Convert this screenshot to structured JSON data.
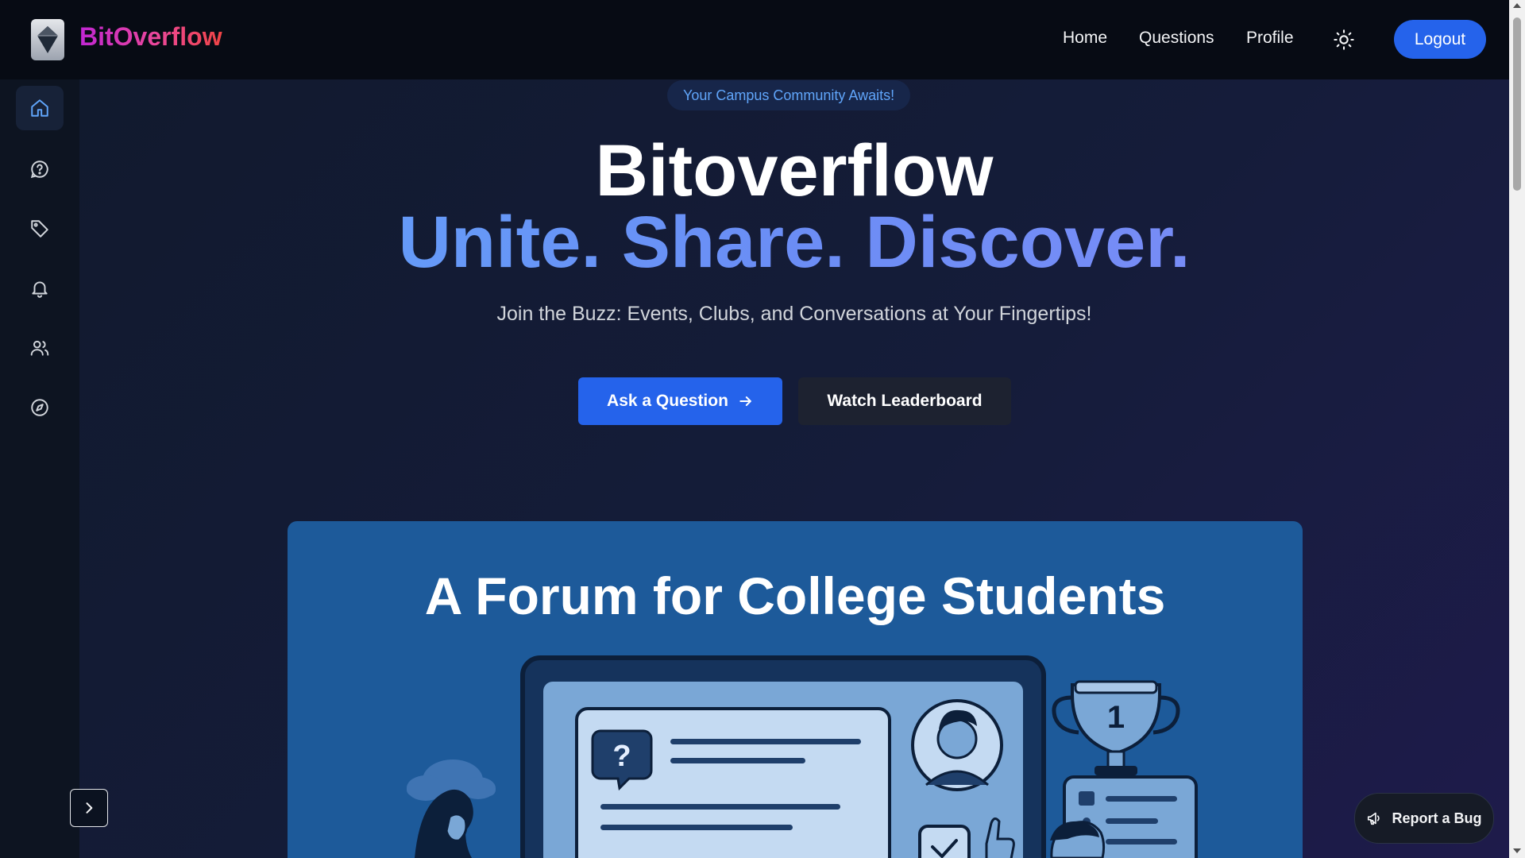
{
  "app": {
    "brand": "BitOverflow"
  },
  "nav": {
    "links": [
      "Home",
      "Questions",
      "Profile"
    ],
    "theme_icon": "sun-icon",
    "logout_label": "Logout"
  },
  "sidebar": {
    "items": [
      {
        "icon": "home-icon",
        "active": true
      },
      {
        "icon": "question-chat-icon",
        "active": false
      },
      {
        "icon": "tag-icon",
        "active": false
      },
      {
        "icon": "bell-icon",
        "active": false
      },
      {
        "icon": "users-icon",
        "active": false
      },
      {
        "icon": "compass-icon",
        "active": false
      }
    ],
    "expand_icon": "chevron-right-icon"
  },
  "hero": {
    "badge": "Your Campus Community Awaits!",
    "title": "Bitoverflow",
    "tagline": "Unite. Share. Discover.",
    "subtitle": "Join the Buzz: Events, Clubs, and Conversations at Your Fingertips!",
    "primary_cta": "Ask a Question",
    "secondary_cta": "Watch Leaderboard"
  },
  "feature_card": {
    "title": "A Forum for College Students",
    "trophy_rank": "1"
  },
  "report": {
    "label": "Report a Bug",
    "icon": "megaphone-icon"
  },
  "colors": {
    "accent": "#2563eb",
    "brand_gradient_start": "#c026d3",
    "brand_gradient_end": "#ef4444",
    "tagline_gradient_start": "#60a5fa",
    "tagline_gradient_end": "#818cf8",
    "card_bg": "#1d5a9a"
  }
}
